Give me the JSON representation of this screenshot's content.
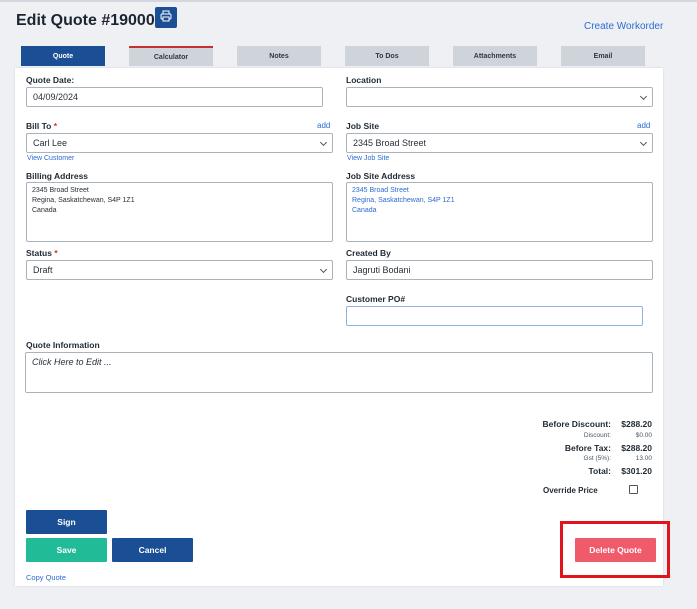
{
  "page": {
    "title": "Edit Quote #190009",
    "create_workorder": "Create Workorder"
  },
  "icons": {
    "print": "printer-icon"
  },
  "tabs": [
    {
      "label": "Quote"
    },
    {
      "label": "Calculator"
    },
    {
      "label": "Notes"
    },
    {
      "label": "To Dos"
    },
    {
      "label": "Attachments"
    },
    {
      "label": "Email"
    }
  ],
  "form": {
    "quote_date": {
      "label": "Quote Date:",
      "value": "04/09/2024"
    },
    "location": {
      "label": "Location",
      "value": ""
    },
    "bill_to": {
      "label": "Bill To",
      "required": "*",
      "add": "add",
      "value": "Carl Lee",
      "view_link": "View Customer"
    },
    "job_site": {
      "label": "Job Site",
      "add": "add",
      "value": "2345 Broad Street",
      "view_link": "View Job Site"
    },
    "billing_address": {
      "label": "Billing Address",
      "lines": [
        "2345 Broad Street",
        "Regina, Saskatchewan, S4P 1Z1",
        "Canada"
      ]
    },
    "job_site_address": {
      "label": "Job Site Address",
      "lines": [
        "2345 Broad Street",
        "Regina, Saskatchewan, S4P 1Z1",
        "Canada"
      ]
    },
    "status": {
      "label": "Status",
      "required": "*",
      "value": "Draft"
    },
    "created_by": {
      "label": "Created By",
      "value": "Jagruti Bodani"
    },
    "customer_po": {
      "label": "Customer PO#",
      "value": ""
    },
    "quote_information": {
      "label": "Quote Information",
      "placeholder": "Click Here to Edit ..."
    }
  },
  "totals": {
    "before_discount": {
      "label": "Before Discount:",
      "value": "$288.20"
    },
    "discount": {
      "label": "Discount:",
      "value": "$0.00"
    },
    "before_tax": {
      "label": "Before Tax:",
      "value": "$288.20"
    },
    "gst": {
      "label": "Gst (5%):",
      "value": "13.00"
    },
    "total": {
      "label": "Total:",
      "value": "$301.20"
    }
  },
  "override_price": {
    "label": "Override Price",
    "checked": false
  },
  "buttons": {
    "sign": "Sign",
    "save": "Save",
    "cancel": "Cancel",
    "delete": "Delete Quote",
    "copy": "Copy Quote"
  },
  "colors": {
    "primary": "#1a4f95",
    "save": "#21bc97",
    "delete": "#ef5b6b",
    "highlight": "#e0151b",
    "link": "#2e6ad1"
  }
}
